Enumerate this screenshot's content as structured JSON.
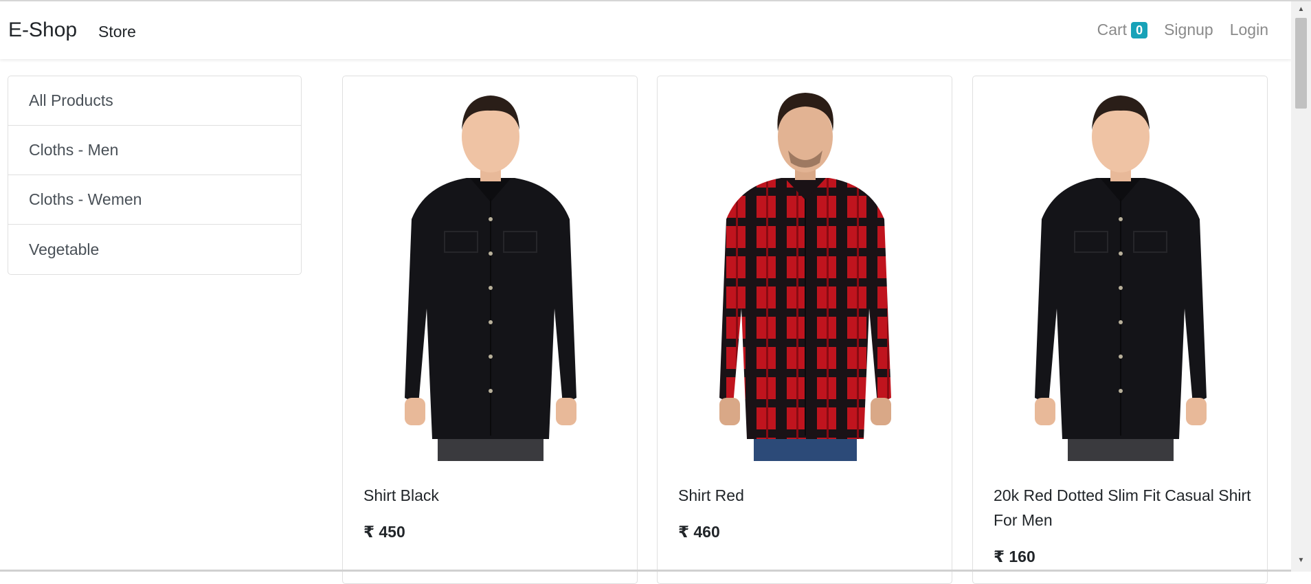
{
  "navbar": {
    "brand": "E-Shop",
    "store_link": "Store",
    "cart_label": "Cart",
    "cart_count": "0",
    "signup": "Signup",
    "login": "Login"
  },
  "sidebar": {
    "items": [
      {
        "label": "All Products"
      },
      {
        "label": "Cloths - Men"
      },
      {
        "label": "Cloths - Wemen"
      },
      {
        "label": "Vegetable"
      }
    ]
  },
  "products": [
    {
      "name": "Shirt Black",
      "price": "₹ 450",
      "image": "black-shirt-model"
    },
    {
      "name": "Shirt Red",
      "price": "₹ 460",
      "image": "red-plaid-shirt-model"
    },
    {
      "name": "20k Red Dotted Slim Fit Casual Shirt For Men",
      "price": "₹ 160",
      "image": "black-shirt-model"
    }
  ],
  "colors": {
    "badge": "#17a2b8",
    "shirt_black": "#141418",
    "shirt_red": "#c0141e"
  }
}
